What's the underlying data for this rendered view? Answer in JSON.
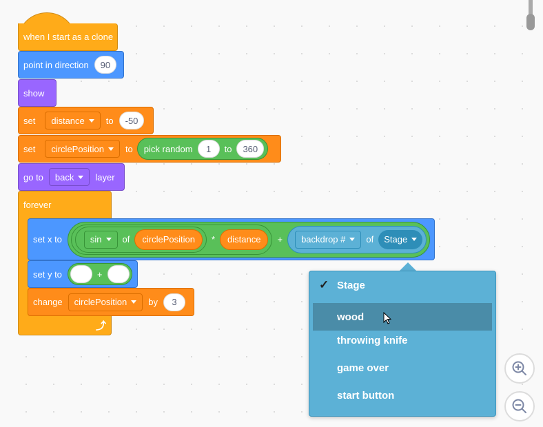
{
  "script": {
    "hat": "when I start as a clone",
    "point": {
      "label": "point in direction",
      "value": "90"
    },
    "show": "show",
    "set1": {
      "label": "set",
      "var": "distance",
      "to": "to",
      "value": "-50"
    },
    "set2": {
      "label": "set",
      "var": "circlePosition",
      "to": "to",
      "pick": "pick random",
      "from": "1",
      "to2": "to",
      "max": "360"
    },
    "goto": {
      "label": "go to",
      "option": "back",
      "suffix": "layer"
    },
    "forever": "forever",
    "setx": {
      "label": "set x to",
      "fn": "sin",
      "of": "of",
      "arg": "circlePosition",
      "times": "*",
      "mult": "distance",
      "plus": "+",
      "prop": "backdrop #",
      "of2": "of",
      "target": "Stage"
    },
    "sety": {
      "label": "set y to",
      "plus": "+"
    },
    "change": {
      "label": "change",
      "var": "circlePosition",
      "by": "by",
      "value": "3"
    }
  },
  "dropdown": {
    "checkmark": "✓",
    "items": [
      {
        "label": "Stage",
        "selected": true
      },
      {
        "label": "wood",
        "hovered": true
      },
      {
        "label": "throwing knife"
      },
      {
        "label": "game over"
      },
      {
        "label": "start button"
      }
    ]
  },
  "colors": {
    "control": "#ffab19",
    "motion": "#4c97ff",
    "looks": "#9966ff",
    "variables": "#ff8c1a",
    "operators": "#59c059",
    "sensing": "#5cb1d6"
  },
  "icons": {
    "zoom_in": "zoom-in-icon",
    "zoom_out": "zoom-out-icon",
    "loop_arrow": "loop-arrow-icon"
  }
}
